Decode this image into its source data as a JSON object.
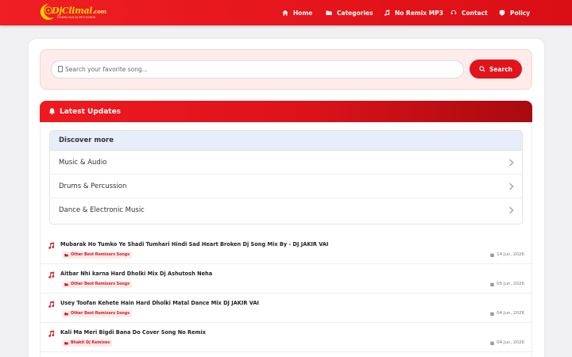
{
  "header": {
    "logo": {
      "text_main": "DjClimal",
      "text_suffix": ".com",
      "tagline": "DOWNLOAD DJ MP3 SONGS"
    },
    "nav": [
      {
        "label": "Home",
        "icon": "home-icon"
      },
      {
        "label": "Categories",
        "icon": "folder-icon"
      },
      {
        "label": "No Remix MP3",
        "icon": "music-note-icon"
      },
      {
        "label": "Contact",
        "icon": "headset-icon"
      },
      {
        "label": "Policy",
        "icon": "shield-icon"
      }
    ]
  },
  "search": {
    "placeholder": "Search your favorite song...",
    "button_label": "Search"
  },
  "updates": {
    "title": "Latest Updates",
    "discover": {
      "title": "Discover more",
      "items": [
        "Music & Audio",
        "Drums & Percussion",
        "Dance & Electronic Music"
      ]
    },
    "songs": [
      {
        "title": "Mubarak Ho Tumko Ye Shadi Tumhari Hindi Sad Heart Broken Dj Song Mix By - DJ JAKIR VAI",
        "category": "Other Best Remixers Songs",
        "date": "14 Jun, 2026"
      },
      {
        "title": "Aitbar Nhi karna Hard Dholki Mix Dj Ashutosh Neha",
        "category": "Other Best Remixers Songs",
        "date": "05 Jun, 2026"
      },
      {
        "title": "Usey Toofan Kehete Hain Hard Dholki Matal Dance Mix DJ JAKIR VAI",
        "category": "Other Best Remixers Songs",
        "date": "04 Jun, 2026"
      },
      {
        "title": "Kali Ma Meri Bigdi Bana Do Cover Song No Remix",
        "category": "Bhakti Dj Remixes",
        "date": "04 Jun, 2026"
      }
    ]
  },
  "colors": {
    "brand_red": "#e2141b",
    "logo_yellow": "#ffd200",
    "discover_bg": "#e8eef9"
  }
}
